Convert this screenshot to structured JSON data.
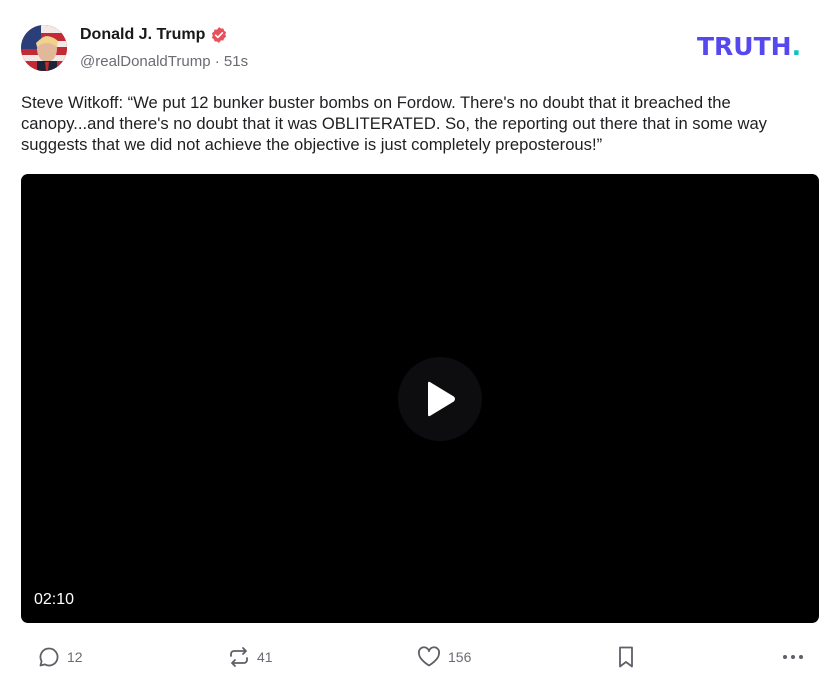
{
  "post": {
    "author_name": "Donald J. Trump",
    "handle": "@realDonaldTrump",
    "separator": "·",
    "time_ago": "51s",
    "text": "Steve Witkoff: “We put 12 bunker buster bombs on Fordow. There's no doubt that it breached the canopy...and there's no doubt that it was OBLITERATED. So, the reporting out there that in some way suggests that we did not achieve the objective is just completely preposterous!”",
    "video": {
      "duration": "02:10"
    },
    "actions": {
      "replies": "12",
      "retruths": "41",
      "likes": "156"
    }
  },
  "brand": {
    "logo_text": "TRUTH",
    "logo_dot": ".",
    "accent_color": "#5448ee",
    "dot_color": "#0bc3c6",
    "verified_color": "#e8505b"
  },
  "icons": {
    "verified": "verified-badge-icon",
    "play": "play-icon",
    "reply": "speech-bubble-icon",
    "retruth": "repost-arrows-icon",
    "like": "heart-icon",
    "bookmark": "bookmark-icon",
    "more": "ellipsis-icon"
  }
}
